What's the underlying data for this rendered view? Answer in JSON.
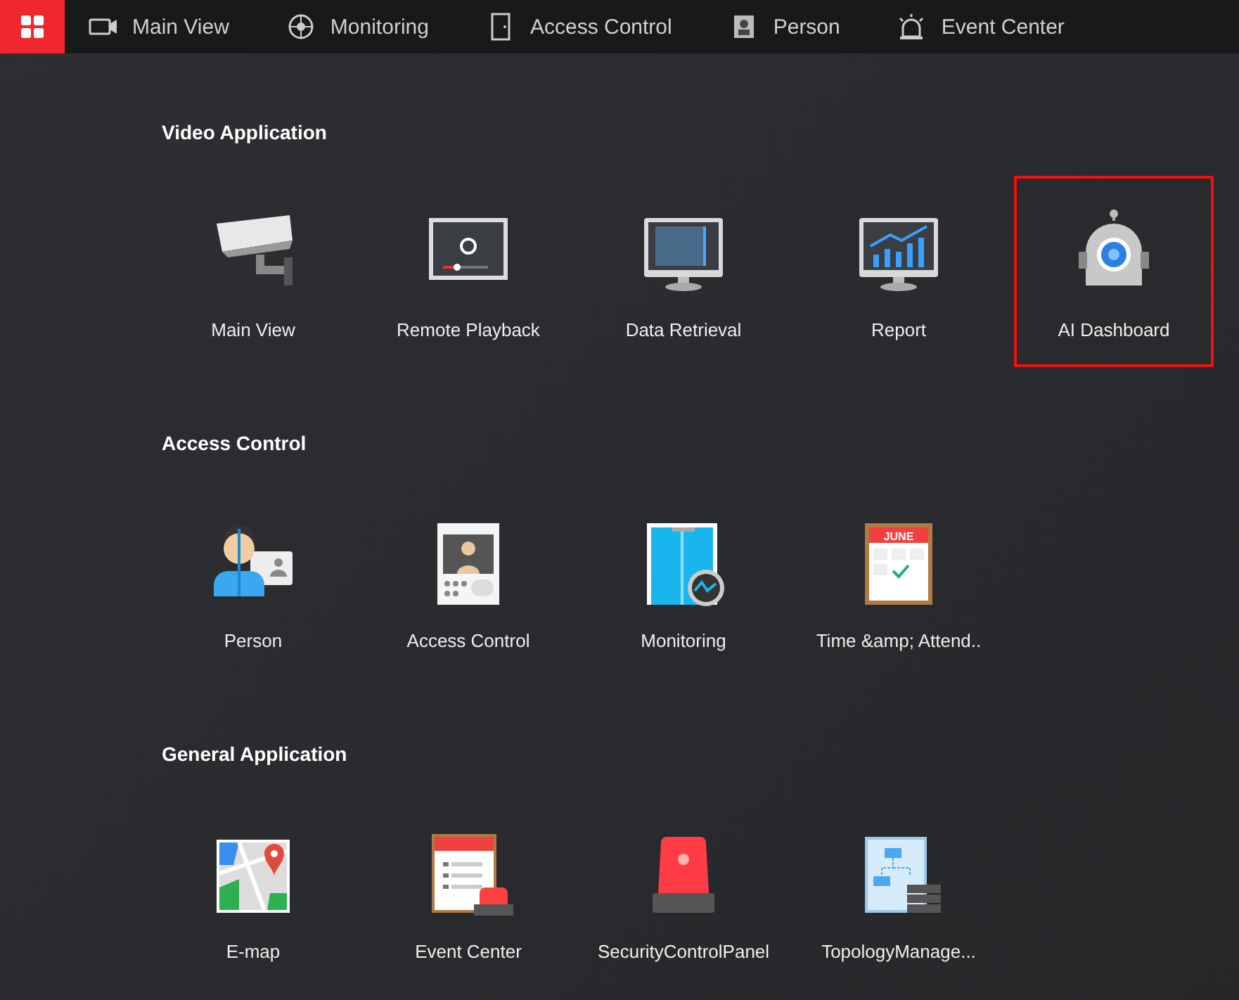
{
  "nav": {
    "menu_selected": true,
    "items": [
      {
        "label": "Main View"
      },
      {
        "label": "Monitoring"
      },
      {
        "label": "Access Control"
      },
      {
        "label": "Person"
      },
      {
        "label": "Event Center"
      }
    ]
  },
  "sections": [
    {
      "title": "Video Application",
      "items": [
        {
          "label": "Main View",
          "highlighted": false
        },
        {
          "label": "Remote Playback",
          "highlighted": false
        },
        {
          "label": "Data Retrieval",
          "highlighted": false
        },
        {
          "label": "Report",
          "highlighted": false
        },
        {
          "label": "AI Dashboard",
          "highlighted": true
        }
      ]
    },
    {
      "title": "Access Control",
      "items": [
        {
          "label": "Person",
          "highlighted": false
        },
        {
          "label": "Access Control",
          "highlighted": false
        },
        {
          "label": "Monitoring",
          "highlighted": false
        },
        {
          "label": "Time &amp; Attend..",
          "icon_text": "JUNE",
          "highlighted": false
        }
      ]
    },
    {
      "title": "General Application",
      "items": [
        {
          "label": "E-map",
          "highlighted": false
        },
        {
          "label": "Event Center",
          "highlighted": false
        },
        {
          "label": "SecurityControlPanel",
          "highlighted": false
        },
        {
          "label": "TopologyManage...",
          "highlighted": false
        }
      ]
    }
  ]
}
